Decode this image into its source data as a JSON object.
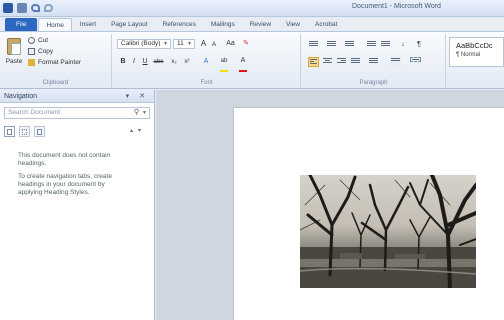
{
  "titlebar": {
    "title": "Document1 - Microsoft Word"
  },
  "tabs": [
    {
      "label": "File"
    },
    {
      "label": "Home"
    },
    {
      "label": "Insert"
    },
    {
      "label": "Page Layout"
    },
    {
      "label": "References"
    },
    {
      "label": "Mailings"
    },
    {
      "label": "Review"
    },
    {
      "label": "View"
    },
    {
      "label": "Acrobat"
    }
  ],
  "ribbon": {
    "clipboard": {
      "paste_label": "Paste",
      "cut_label": "Cut",
      "copy_label": "Copy",
      "format_painter_label": "Format Painter",
      "group_label": "Clipboard"
    },
    "font": {
      "font_name": "Calibri (Body)",
      "font_size": "11",
      "grow": "A",
      "shrink": "A",
      "change_case": "Aa",
      "bold": "B",
      "italic": "I",
      "underline": "U",
      "strike": "abe",
      "subscript": "x₂",
      "superscript": "x²",
      "text_effects": "A",
      "highlight": "ab",
      "font_color": "A",
      "group_label": "Font"
    },
    "paragraph": {
      "show_marks": "¶",
      "sort": "↓",
      "group_label": "Paragraph"
    },
    "styles": {
      "sample": "AaBbCcDc",
      "style_name": "¶ Normal"
    }
  },
  "nav": {
    "title": "Navigation",
    "controls": "▾ ✕",
    "search_placeholder": "Search Document",
    "message_line1": "This document does not contain headings.",
    "message_line2": "To create navigation tabs, create headings in your document by applying Heading Styles."
  },
  "colors": {
    "file_tab": "#2c67c1",
    "ribbon": "#e3eaf4",
    "highlight": "#f5e100",
    "font_color": "#ee1111"
  }
}
